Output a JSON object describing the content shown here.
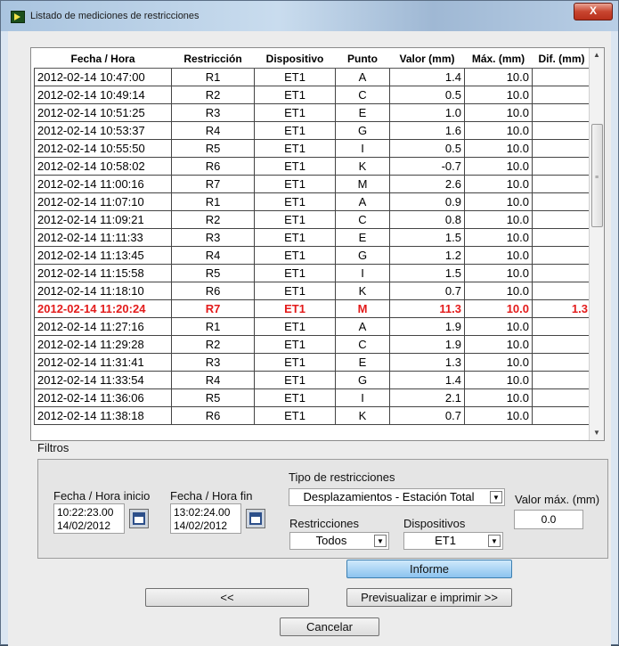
{
  "window": {
    "title": "Listado de mediciones de restricciones",
    "close_label": "X"
  },
  "table": {
    "columns": [
      "Fecha / Hora",
      "Restricción",
      "Dispositivo",
      "Punto",
      "Valor (mm)",
      "Máx. (mm)",
      "Dif. (mm)"
    ],
    "rows": [
      [
        "2012-02-14 10:47:00",
        "R1",
        "ET1",
        "A",
        "1.4",
        "10.0",
        ""
      ],
      [
        "2012-02-14 10:49:14",
        "R2",
        "ET1",
        "C",
        "0.5",
        "10.0",
        ""
      ],
      [
        "2012-02-14 10:51:25",
        "R3",
        "ET1",
        "E",
        "1.0",
        "10.0",
        ""
      ],
      [
        "2012-02-14 10:53:37",
        "R4",
        "ET1",
        "G",
        "1.6",
        "10.0",
        ""
      ],
      [
        "2012-02-14 10:55:50",
        "R5",
        "ET1",
        "I",
        "0.5",
        "10.0",
        ""
      ],
      [
        "2012-02-14 10:58:02",
        "R6",
        "ET1",
        "K",
        "-0.7",
        "10.0",
        ""
      ],
      [
        "2012-02-14 11:00:16",
        "R7",
        "ET1",
        "M",
        "2.6",
        "10.0",
        ""
      ],
      [
        "2012-02-14 11:07:10",
        "R1",
        "ET1",
        "A",
        "0.9",
        "10.0",
        ""
      ],
      [
        "2012-02-14 11:09:21",
        "R2",
        "ET1",
        "C",
        "0.8",
        "10.0",
        ""
      ],
      [
        "2012-02-14 11:11:33",
        "R3",
        "ET1",
        "E",
        "1.5",
        "10.0",
        ""
      ],
      [
        "2012-02-14 11:13:45",
        "R4",
        "ET1",
        "G",
        "1.2",
        "10.0",
        ""
      ],
      [
        "2012-02-14 11:15:58",
        "R5",
        "ET1",
        "I",
        "1.5",
        "10.0",
        ""
      ],
      [
        "2012-02-14 11:18:10",
        "R6",
        "ET1",
        "K",
        "0.7",
        "10.0",
        ""
      ],
      [
        "2012-02-14 11:20:24",
        "R7",
        "ET1",
        "M",
        "11.3",
        "10.0",
        "1.3"
      ],
      [
        "2012-02-14 11:27:16",
        "R1",
        "ET1",
        "A",
        "1.9",
        "10.0",
        ""
      ],
      [
        "2012-02-14 11:29:28",
        "R2",
        "ET1",
        "C",
        "1.9",
        "10.0",
        ""
      ],
      [
        "2012-02-14 11:31:41",
        "R3",
        "ET1",
        "E",
        "1.3",
        "10.0",
        ""
      ],
      [
        "2012-02-14 11:33:54",
        "R4",
        "ET1",
        "G",
        "1.4",
        "10.0",
        ""
      ],
      [
        "2012-02-14 11:36:06",
        "R5",
        "ET1",
        "I",
        "2.1",
        "10.0",
        ""
      ],
      [
        "2012-02-14 11:38:18",
        "R6",
        "ET1",
        "K",
        "0.7",
        "10.0",
        ""
      ]
    ],
    "highlight_row_index": 13,
    "highlight_color": "#e31b1b"
  },
  "filters": {
    "title": "Filtros",
    "start": {
      "label": "Fecha / Hora inicio",
      "time": "10:22:23.00",
      "date": "14/02/2012"
    },
    "end": {
      "label": "Fecha / Hora fin",
      "time": "13:02:24.00",
      "date": "14/02/2012"
    },
    "type": {
      "label": "Tipo de restricciones",
      "value": "Desplazamientos - Estación Total"
    },
    "restrictions": {
      "label": "Restricciones",
      "value": "Todos"
    },
    "devices": {
      "label": "Dispositivos",
      "value": "ET1"
    },
    "max_value": {
      "label": "Valor máx. (mm)",
      "value": "0.0"
    }
  },
  "buttons": {
    "report": "Informe",
    "back": "<<",
    "preview": "Previsualizar e imprimir >>",
    "cancel": "Cancelar"
  },
  "icons": {
    "calendar": "calendar-icon",
    "dropdown": "chevron-down-icon",
    "app": "app-icon"
  }
}
